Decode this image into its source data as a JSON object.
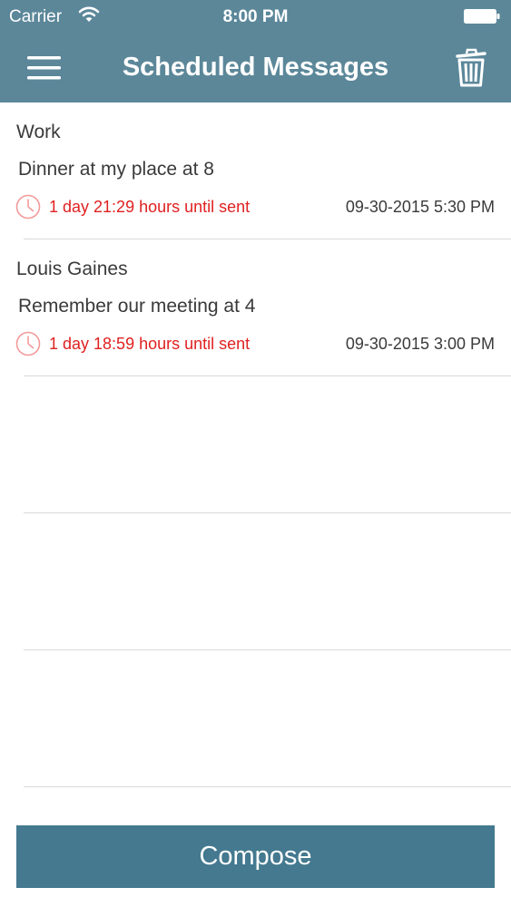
{
  "status_bar": {
    "carrier": "Carrier",
    "time": "8:00 PM"
  },
  "nav": {
    "title": "Scheduled Messages",
    "left_icon": "menu-icon",
    "right_icon": "trash-icon"
  },
  "messages": [
    {
      "recipient": "Work",
      "text": "Dinner at my place at 8",
      "countdown": "1 day 21:29 hours until sent",
      "send_time": "09-30-2015 5:30 PM"
    },
    {
      "recipient": "Louis Gaines",
      "text": "Remember our meeting at 4",
      "countdown": "1 day 18:59 hours until sent",
      "send_time": "09-30-2015 3:00 PM"
    }
  ],
  "compose_label": "Compose",
  "colors": {
    "header": "#5b8799",
    "compose": "#44798f",
    "countdown": "#e02020"
  }
}
